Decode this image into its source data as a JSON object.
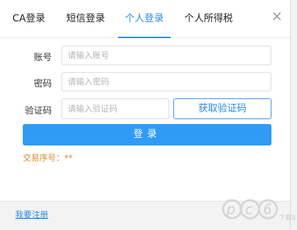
{
  "tabs": [
    {
      "label": "CA登录"
    },
    {
      "label": "短信登录"
    },
    {
      "label": "个人登录"
    },
    {
      "label": "个人所得税"
    }
  ],
  "close_glyph": "×",
  "form": {
    "account_label": "账号",
    "account_placeholder": "请输入账号",
    "password_label": "密码",
    "password_placeholder": "请输入密码",
    "code_label": "验证码",
    "code_placeholder": "请输入验证码",
    "get_code_button": "获取验证码",
    "login_button": "登录",
    "serial_text": "交易序号：**"
  },
  "footer": {
    "register_link": "我要注册"
  },
  "watermark": {
    "logo": "pc6",
    "sub": "下载站"
  },
  "colors": {
    "accent": "#2b8be0",
    "login_button": "#2f9bf4",
    "serial": "#d98a2b"
  },
  "icons": {
    "close": "close-icon"
  }
}
